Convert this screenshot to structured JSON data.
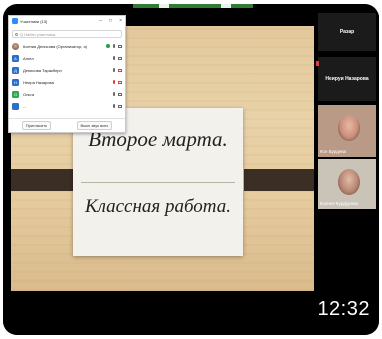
{
  "participants_window": {
    "title": "Участники (13)",
    "search_placeholder": "Q Найти участника",
    "participants": [
      {
        "name": "Ксения Денисова (Организатор, я)",
        "initial": "",
        "color": "",
        "avatar": "photo",
        "mic_muted": false,
        "cam_off": false
      },
      {
        "name": "Ангел",
        "initial": "А",
        "color": "#2d6ec8",
        "avatar": "letter",
        "mic_muted": false,
        "cam_off": false
      },
      {
        "name": "Денисова Таракберн",
        "initial": "Д",
        "color": "#2d6ec8",
        "avatar": "letter",
        "mic_muted": false,
        "cam_off": true
      },
      {
        "name": "Неира Назарова",
        "initial": "Н",
        "color": "#2d6ec8",
        "avatar": "letter",
        "mic_muted": true,
        "cam_off": true
      },
      {
        "name": "Ольга",
        "initial": "О",
        "color": "#2fa84f",
        "avatar": "letter",
        "mic_muted": false,
        "cam_off": false
      },
      {
        "name": "...",
        "initial": "",
        "color": "#2d6ec8",
        "avatar": "letter",
        "mic_muted": false,
        "cam_off": false
      }
    ],
    "invite_label": "Пригласить",
    "mute_all_label": "Выкл звук всех"
  },
  "slide": {
    "line1": "Второе марта.",
    "line2": "Классная работа."
  },
  "video_tiles": [
    {
      "name": "Разар"
    },
    {
      "name": "Неируи Назарова"
    },
    {
      "name": "Ксе Бурдева"
    },
    {
      "name": "Ксения Курдурова"
    }
  ],
  "video_time": "12:32",
  "colors": {
    "share_green": "#2e7d32",
    "zoom_blue": "#2d8cff",
    "muted_red": "#e53935"
  }
}
